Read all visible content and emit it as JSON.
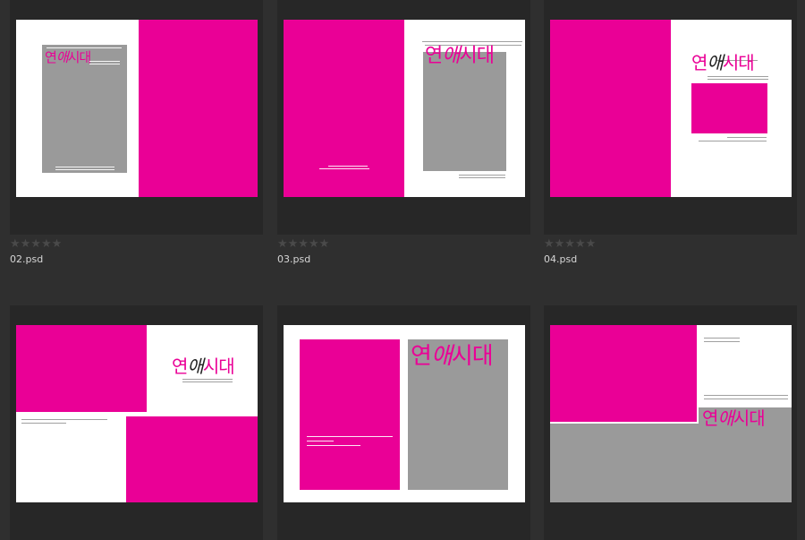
{
  "logo": {
    "a": "연",
    "b": "애",
    "c": "시대"
  },
  "rating_glyphs": "★★★★★",
  "items": [
    {
      "filename": "02.psd",
      "rating": 0
    },
    {
      "filename": "03.psd",
      "rating": 0
    },
    {
      "filename": "04.psd",
      "rating": 0
    },
    {
      "filename": "",
      "rating": 0
    },
    {
      "filename": "",
      "rating": 0
    },
    {
      "filename": "",
      "rating": 0
    }
  ],
  "colors": {
    "accent": "#ea0096",
    "placeholder": "#9a9a9a",
    "background": "#2f2f2f"
  }
}
